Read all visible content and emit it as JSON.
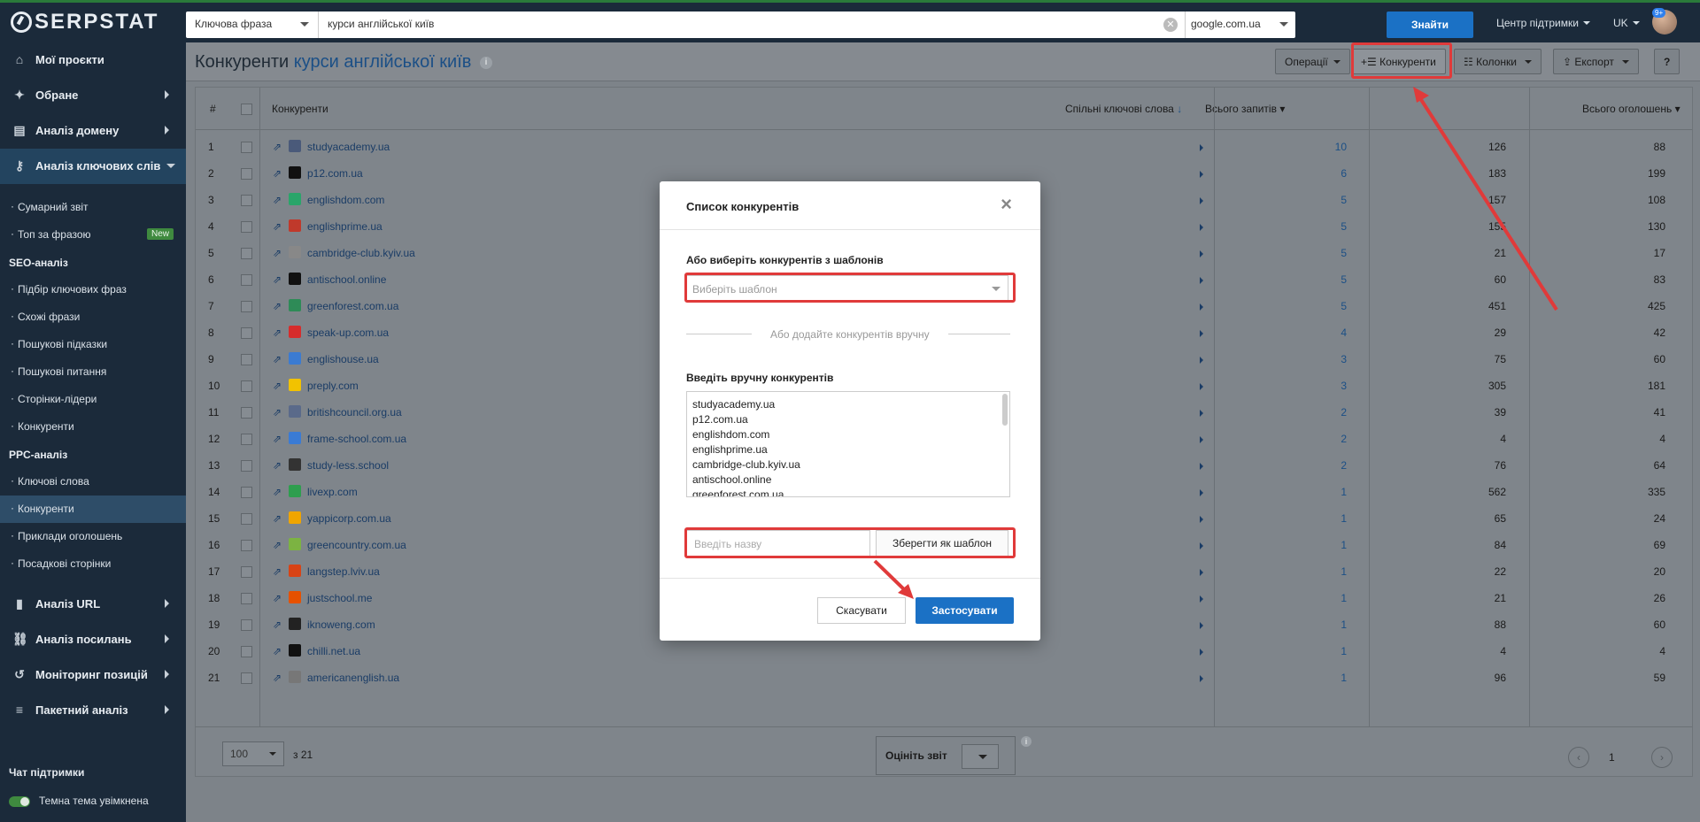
{
  "topbar": {
    "logo": "SERPSTAT",
    "search_type": "Ключова фраза",
    "search_query": "курси англійської київ",
    "database": "google.com.ua",
    "find_label": "Знайти",
    "support_label": "Центр підтримки",
    "lang_label": "UK",
    "avatar_badge": "9+"
  },
  "sidebar": {
    "main_items": [
      {
        "label": "Мої проєкти",
        "icon": "home-icon"
      },
      {
        "label": "Обране",
        "icon": "pin-icon"
      },
      {
        "label": "Аналіз домену",
        "icon": "domain-analysis-icon"
      },
      {
        "label": "Аналіз ключових слів",
        "icon": "key-icon"
      }
    ],
    "kw_sub": [
      "Сумарний звіт",
      "Топ за фразою"
    ],
    "new_badge": "New",
    "seo_head": "SEO-аналіз",
    "seo_items": [
      "Підбір ключових фраз",
      "Схожі фрази",
      "Пошукові підказки",
      "Пошукові питання",
      "Сторінки-лідери",
      "Конкуренти"
    ],
    "ppc_head": "PPC-аналіз",
    "ppc_items": [
      "Ключові слова",
      "Конкуренти",
      "Приклади оголошень",
      "Посадкові сторінки"
    ],
    "bottom_items": [
      {
        "label": "Аналіз URL",
        "icon": "chart-bars-icon"
      },
      {
        "label": "Аналіз посилань",
        "icon": "link-icon"
      },
      {
        "label": "Моніторинг позицій",
        "icon": "history-icon"
      },
      {
        "label": "Пакетний аналіз",
        "icon": "database-icon"
      }
    ],
    "chat": "Чат підтримки",
    "theme": "Темна тема увімкнена"
  },
  "page": {
    "title_prefix": "Конкуренти",
    "title_keyword": "курси англійської київ",
    "toolbar": {
      "operations": "Операції",
      "competitors": "Конкуренти",
      "columns": "Колонки",
      "export": "Експорт",
      "help": "?"
    }
  },
  "table": {
    "headers": {
      "num": "#",
      "competitor": "Конкуренти",
      "common": "Спільні ключові слова",
      "total_queries": "Всього запитів",
      "total_ads": "Всього оголошень"
    },
    "rows": [
      {
        "n": "1",
        "domain": "studyacademy.ua",
        "common": "10",
        "queries": "126",
        "ads": "88",
        "fav": "#4a5a7a"
      },
      {
        "n": "2",
        "domain": "p12.com.ua",
        "common": "6",
        "queries": "183",
        "ads": "199",
        "fav": "#111111"
      },
      {
        "n": "3",
        "domain": "englishdom.com",
        "common": "5",
        "queries": "157",
        "ads": "108",
        "fav": "#2aa56a"
      },
      {
        "n": "4",
        "domain": "englishprime.ua",
        "common": "5",
        "queries": "155",
        "ads": "130",
        "fav": "#c0392b"
      },
      {
        "n": "5",
        "domain": "cambridge-club.kyiv.ua",
        "common": "5",
        "queries": "21",
        "ads": "17",
        "fav": "#888888"
      },
      {
        "n": "6",
        "domain": "antischool.online",
        "common": "5",
        "queries": "60",
        "ads": "83",
        "fav": "#111111"
      },
      {
        "n": "7",
        "domain": "greenforest.com.ua",
        "common": "5",
        "queries": "451",
        "ads": "425",
        "fav": "#2e8b57"
      },
      {
        "n": "8",
        "domain": "speak-up.com.ua",
        "common": "4",
        "queries": "29",
        "ads": "42",
        "fav": "#d62c2c"
      },
      {
        "n": "9",
        "domain": "englishouse.ua",
        "common": "3",
        "queries": "75",
        "ads": "60",
        "fav": "#3b7bd1"
      },
      {
        "n": "10",
        "domain": "preply.com",
        "common": "3",
        "queries": "305",
        "ads": "181",
        "fav": "#f2c200"
      },
      {
        "n": "11",
        "domain": "britishcouncil.org.ua",
        "common": "2",
        "queries": "39",
        "ads": "41",
        "fav": "#5a6a8a"
      },
      {
        "n": "12",
        "domain": "frame-school.com.ua",
        "common": "2",
        "queries": "4",
        "ads": "4",
        "fav": "#3a7bd5"
      },
      {
        "n": "13",
        "domain": "study-less.school",
        "common": "2",
        "queries": "76",
        "ads": "64",
        "fav": "#333333"
      },
      {
        "n": "14",
        "domain": "livexp.com",
        "common": "1",
        "queries": "562",
        "ads": "335",
        "fav": "#2e9e4e"
      },
      {
        "n": "15",
        "domain": "yappicorp.com.ua",
        "common": "1",
        "queries": "65",
        "ads": "24",
        "fav": "#f0a500"
      },
      {
        "n": "16",
        "domain": "greencountry.com.ua",
        "common": "1",
        "queries": "84",
        "ads": "69",
        "fav": "#7cb342"
      },
      {
        "n": "17",
        "domain": "langstep.lviv.ua",
        "common": "1",
        "queries": "22",
        "ads": "20",
        "fav": "#d84315"
      },
      {
        "n": "18",
        "domain": "justschool.me",
        "common": "1",
        "queries": "21",
        "ads": "26",
        "fav": "#e65100"
      },
      {
        "n": "19",
        "domain": "iknoweng.com",
        "common": "1",
        "queries": "88",
        "ads": "60",
        "fav": "#222222"
      },
      {
        "n": "20",
        "domain": "chilli.net.ua",
        "common": "1",
        "queries": "4",
        "ads": "4",
        "fav": "#111111"
      },
      {
        "n": "21",
        "domain": "americanenglish.ua",
        "common": "1",
        "queries": "96",
        "ads": "59",
        "fav": "#777777"
      }
    ],
    "footer": {
      "per_page": "100",
      "of_total": "з 21",
      "rate": "Оцініть звіт",
      "page": "1"
    }
  },
  "modal": {
    "title": "Список конкурентів",
    "template_label": "Або виберіть конкурентів з шаблонів",
    "template_placeholder": "Виберіть шаблон",
    "divider_text": "Або додайте конкурентів вручну",
    "manual_label": "Введіть вручну конкурентів",
    "manual_list": [
      "studyacademy.ua",
      "p12.com.ua",
      "englishdom.com",
      "englishprime.ua",
      "cambridge-club.kyiv.ua",
      "antischool.online",
      "greenforest.com.ua"
    ],
    "name_placeholder": "Введіть назву",
    "save_template": "Зберегти як шаблон",
    "cancel": "Скасувати",
    "apply": "Застосувати"
  },
  "colors": {
    "accent_blue": "#1b71c5",
    "highlight_red": "#e03a3a",
    "sidebar_bg": "#1b2a3a"
  }
}
